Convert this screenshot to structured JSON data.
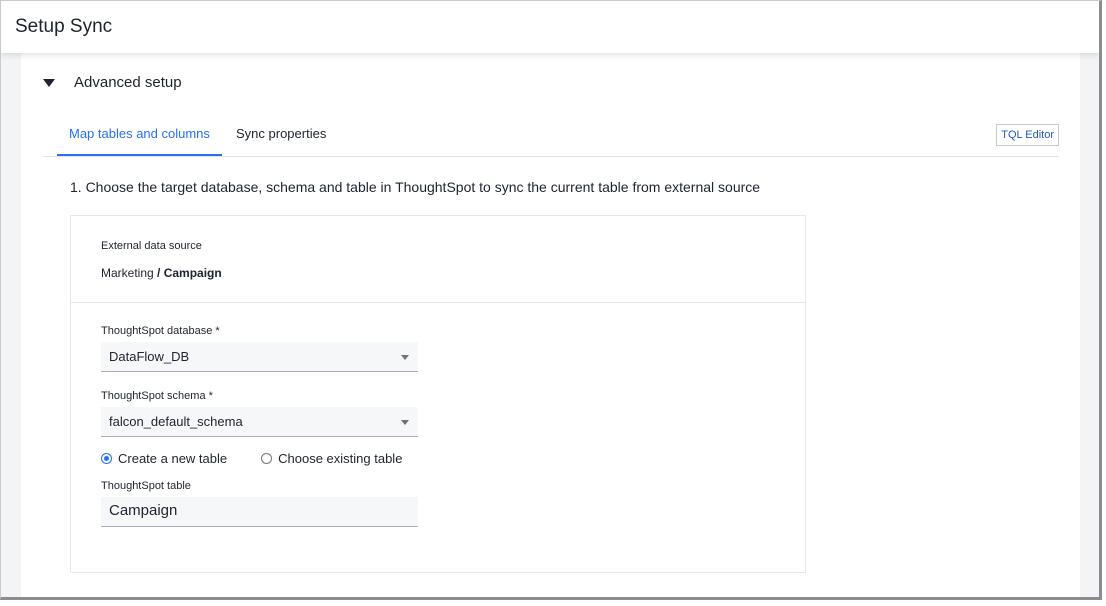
{
  "header": {
    "title": "Setup Sync"
  },
  "section": {
    "title": "Advanced setup"
  },
  "tabs": [
    {
      "label": "Map tables and columns"
    },
    {
      "label": "Sync properties"
    }
  ],
  "toolbar": {
    "tql_label": "TQL Editor"
  },
  "step": {
    "text": "1. Choose the target database, schema and table in ThoughtSpot to sync the current table from external source"
  },
  "source": {
    "label": "External data source",
    "database": "Marketing",
    "separator": " / ",
    "table": "Campaign"
  },
  "form": {
    "database_label": "ThoughtSpot database *",
    "database_value": "DataFlow_DB",
    "schema_label": "ThoughtSpot schema *",
    "schema_value": "falcon_default_schema",
    "radio_new": "Create a new table",
    "radio_existing": "Choose existing table",
    "table_label": "ThoughtSpot table",
    "table_value": "Campaign"
  },
  "colors": {
    "accent": "#2770ef"
  }
}
